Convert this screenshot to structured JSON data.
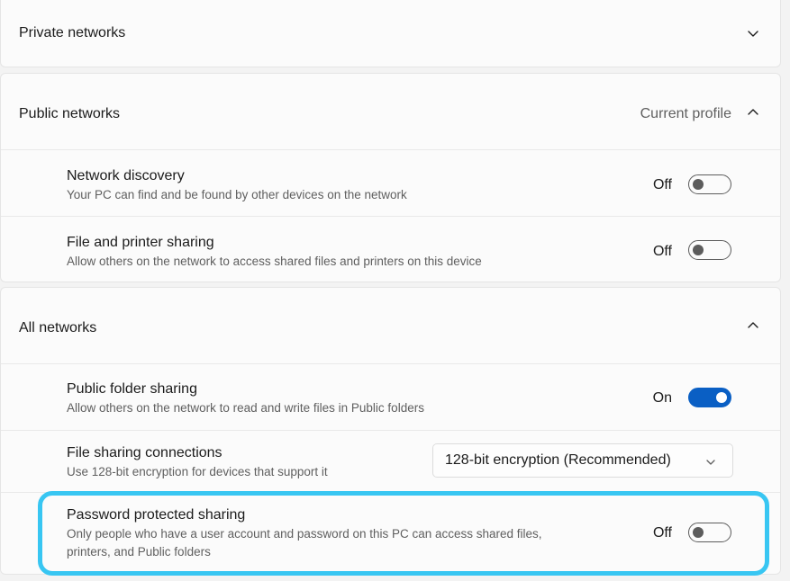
{
  "private_networks": {
    "title": "Private networks",
    "chevron": "chevron-down-icon"
  },
  "public_networks": {
    "title": "Public networks",
    "status": "Current profile",
    "chevron": "chevron-up-icon",
    "items": [
      {
        "title": "Network discovery",
        "description": "Your PC can find and be found by other devices on the network",
        "state": "Off"
      },
      {
        "title": "File and printer sharing",
        "description": "Allow others on the network to access shared files and printers on this device",
        "state": "Off"
      }
    ]
  },
  "all_networks": {
    "title": "All networks",
    "chevron": "chevron-up-icon",
    "public_folder_sharing": {
      "title": "Public folder sharing",
      "description": "Allow others on the network to read and write files in Public folders",
      "state": "On"
    },
    "file_sharing_connections": {
      "title": "File sharing connections",
      "description": "Use 128-bit encryption for devices that support it",
      "selected": "128-bit encryption (Recommended)"
    },
    "password_protected_sharing": {
      "title": "Password protected sharing",
      "description_line1": "Only people who have a user account and password on this PC can access shared files,",
      "description_line2": "printers, and Public folders",
      "state": "Off"
    }
  },
  "colors": {
    "accent": "#0a5fc4",
    "highlight": "#38c6f2"
  }
}
